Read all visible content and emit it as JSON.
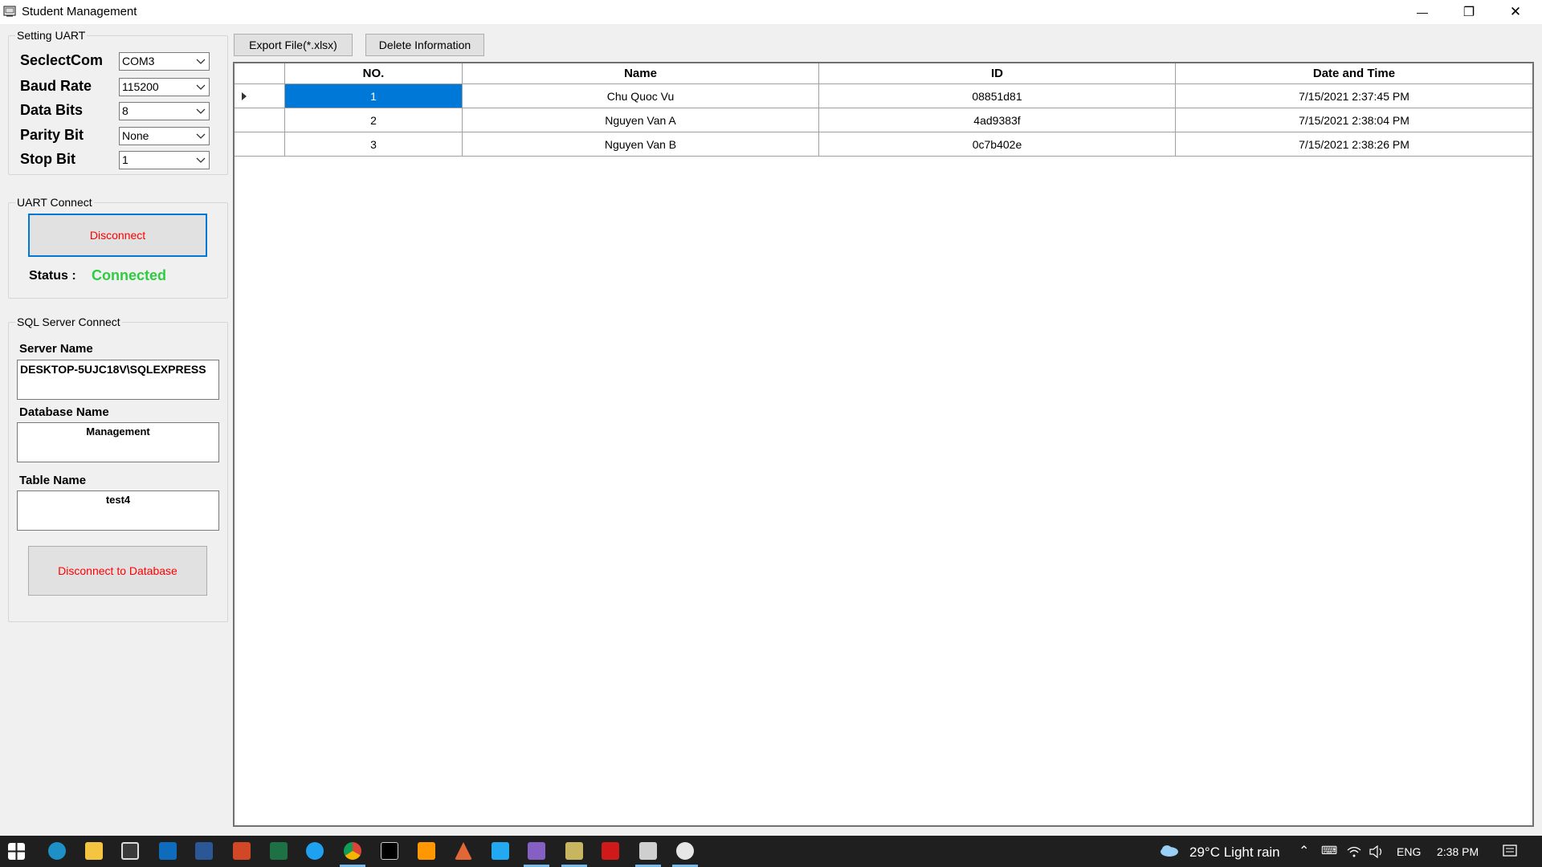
{
  "window": {
    "title": "Student Management",
    "minimize_glyph": "—",
    "maximize_glyph": "❐",
    "close_glyph": "✕"
  },
  "toolbar": {
    "export_label": "Export File(*.xlsx)",
    "delete_label": "Delete Information"
  },
  "setting_uart": {
    "title": "Setting UART",
    "fields": [
      {
        "label": "SeclectCom",
        "value": "COM3"
      },
      {
        "label": "Baud Rate",
        "value": "115200"
      },
      {
        "label": "Data Bits",
        "value": "8"
      },
      {
        "label": "Parity Bit",
        "value": "None"
      },
      {
        "label": "Stop Bit",
        "value": "1"
      }
    ]
  },
  "uart_connect": {
    "title": "UART Connect",
    "button_label": "Disconnect",
    "status_label": "Status :",
    "status_value": "Connected",
    "status_color": "#2ecc40",
    "button_text_color": "#ff0000"
  },
  "sql_connect": {
    "title": "SQL Server Connect",
    "server_label": "Server Name",
    "server_value": "DESKTOP-5UJC18V\\SQLEXPRESS",
    "database_label": "Database Name",
    "database_value": "Management",
    "table_label": "Table Name",
    "table_value": "test4",
    "button_label": "Disconnect to Database"
  },
  "grid": {
    "columns": [
      "NO.",
      "Name",
      "ID",
      "Date and Time"
    ],
    "rows": [
      {
        "no": "1",
        "name": "Chu Quoc Vu",
        "id": "08851d81",
        "datetime": "7/15/2021 2:37:45 PM",
        "selected": true
      },
      {
        "no": "2",
        "name": "Nguyen Van A",
        "id": "4ad9383f",
        "datetime": "7/15/2021 2:38:04 PM",
        "selected": false
      },
      {
        "no": "3",
        "name": "Nguyen Van B",
        "id": "0c7b402e",
        "datetime": "7/15/2021 2:38:26 PM",
        "selected": false
      }
    ],
    "selection_color": "#0078d7"
  },
  "taskbar": {
    "weather": "29°C  Light rain",
    "language": "ENG",
    "time": "2:38 PM",
    "apps": [
      "start-icon",
      "edge-icon",
      "file-explorer-icon",
      "store-icon",
      "mail-icon",
      "word-icon",
      "powerpoint-icon",
      "excel-icon",
      "internet-explorer-icon",
      "chrome-icon",
      "pycharm-icon",
      "sublime-icon",
      "matlab-icon",
      "vscode-icon",
      "visual-studio-icon",
      "tools-icon",
      "red-app-icon",
      "student-management-icon",
      "paint-icon"
    ]
  }
}
